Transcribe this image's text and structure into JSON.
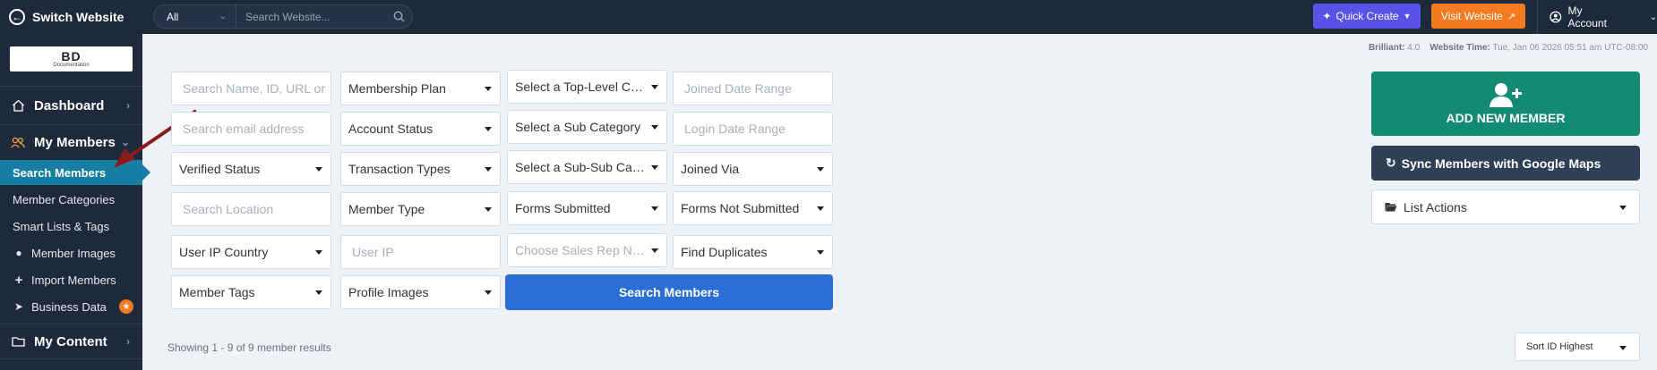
{
  "topbar": {
    "switch_label": "Switch Website",
    "search_scope": "All",
    "search_placeholder": "Search Website...",
    "quick_create": "Quick Create",
    "visit_website": "Visit Website",
    "my_account": "My Account"
  },
  "logo": {
    "big": "BD",
    "small": "Documentation"
  },
  "sidebar": {
    "dashboard": "Dashboard",
    "my_members": "My Members",
    "my_content": "My Content",
    "items": [
      {
        "label": "Search Members"
      },
      {
        "label": "Member Categories"
      },
      {
        "label": "Smart Lists & Tags"
      },
      {
        "label": "Member Images"
      },
      {
        "label": "Import Members"
      },
      {
        "label": "Business Data"
      }
    ]
  },
  "info": {
    "version_label": "Brilliant:",
    "version": "4.0",
    "time_label": "Website Time:",
    "time": "Tue, Jan 06 2026 05:51 am UTC-08:00"
  },
  "filters": {
    "search_name": "Search Name, ID, URL or",
    "search_email": "Search email address",
    "verified_status": "Verified Status",
    "search_location": "Search Location",
    "user_ip_country": "User IP Country",
    "member_tags": "Member Tags",
    "membership_plan": "Membership Plan",
    "account_status": "Account Status",
    "transaction_types": "Transaction Types",
    "member_type": "Member Type",
    "user_ip": "User IP",
    "profile_images": "Profile Images",
    "top_category": "Select a Top-Level Category",
    "sub_category": "Select a Sub Category",
    "sub_sub_category": "Select a Sub-Sub Category",
    "forms_submitted": "Forms Submitted",
    "sales_rep": "Choose Sales Rep Name",
    "joined_date": "Joined Date Range",
    "login_date": "Login Date Range",
    "joined_via": "Joined Via",
    "forms_not_submitted": "Forms Not Submitted",
    "find_duplicates": "Find Duplicates",
    "search_button": "Search Members"
  },
  "results": {
    "showing": "Showing 1 - 9 of 9 member results",
    "sort": "Sort ID Highest"
  },
  "panel": {
    "add_member": "ADD NEW MEMBER",
    "sync": "Sync Members with Google Maps",
    "list_actions": "List Actions"
  },
  "colors": {
    "sidebar_bg": "#1e2a3b",
    "active": "#167ea2",
    "quick_create": "#5a52e8",
    "visit": "#f47b20",
    "add_member": "#138a73",
    "search_button": "#2b6fd6"
  }
}
